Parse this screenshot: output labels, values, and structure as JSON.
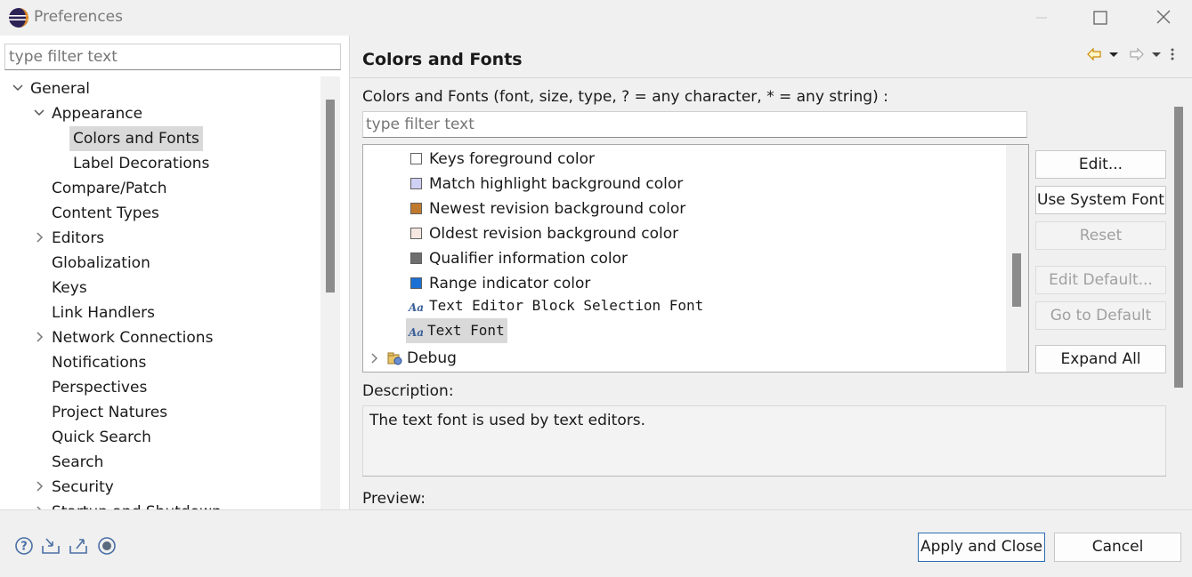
{
  "window": {
    "title": "Preferences",
    "icons": [
      "eclipse-logo-icon",
      "minimize-icon",
      "maximize-icon",
      "close-icon"
    ]
  },
  "left": {
    "filter_placeholder": "type filter text",
    "tree": [
      {
        "label": "General",
        "chevron": "down"
      },
      {
        "label": "Appearance",
        "chevron": "down"
      },
      {
        "label": "Colors and Fonts",
        "selected": true
      },
      {
        "label": "Label Decorations"
      },
      {
        "label": "Compare/Patch"
      },
      {
        "label": "Content Types"
      },
      {
        "label": "Editors",
        "chevron": "right"
      },
      {
        "label": "Globalization"
      },
      {
        "label": "Keys"
      },
      {
        "label": "Link Handlers"
      },
      {
        "label": "Network Connections",
        "chevron": "right"
      },
      {
        "label": "Notifications"
      },
      {
        "label": "Perspectives"
      },
      {
        "label": "Project Natures"
      },
      {
        "label": "Quick Search"
      },
      {
        "label": "Search"
      },
      {
        "label": "Security",
        "chevron": "right"
      },
      {
        "label": "Startup and Shutdown",
        "chevron": "right"
      }
    ]
  },
  "right": {
    "page_title": "Colors and Fonts",
    "filter_label": "Colors and Fonts (font, size, type, ? = any character, * = any string) :",
    "filter_placeholder": "type filter text",
    "items": [
      {
        "label": "Keys foreground color",
        "kind": "color",
        "color": "#ffffff"
      },
      {
        "label": "Match highlight background color",
        "kind": "color",
        "color": "#d0d0f4"
      },
      {
        "label": "Newest revision background color",
        "kind": "color",
        "color": "#c07a2e"
      },
      {
        "label": "Oldest revision background color",
        "kind": "color",
        "color": "#f6e8e0"
      },
      {
        "label": "Qualifier information color",
        "kind": "color",
        "color": "#6e6e6e"
      },
      {
        "label": "Range indicator color",
        "kind": "color",
        "color": "#1c6fd4"
      },
      {
        "label": "Text Editor Block Selection Font",
        "kind": "font"
      },
      {
        "label": "Text Font",
        "kind": "font",
        "selected": true
      },
      {
        "label": "Debug",
        "kind": "category"
      }
    ],
    "buttons": {
      "edit": "Edit...",
      "use_system_font": "Use System Font",
      "reset": "Reset",
      "edit_default": "Edit Default...",
      "go_to_default": "Go to Default",
      "expand_all": "Expand All"
    },
    "description_label": "Description:",
    "description_text": "The text font is used by text editors.",
    "preview_label": "Preview:"
  },
  "bottom": {
    "apply_close": "Apply and Close",
    "cancel": "Cancel",
    "icons": [
      "help-icon",
      "import-icon",
      "export-icon",
      "record-icon"
    ]
  },
  "colors": {
    "accent": "#2e6fb4",
    "selection": "#d9d9d9"
  }
}
